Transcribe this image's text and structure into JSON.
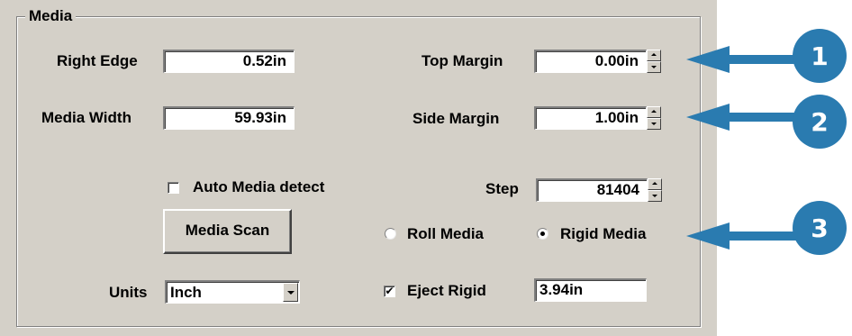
{
  "media_group": {
    "title": "Media",
    "right_edge": {
      "label": "Right Edge",
      "value": "0.52in"
    },
    "media_width": {
      "label": "Media Width",
      "value": "59.93in"
    },
    "top_margin": {
      "label": "Top Margin",
      "value": "0.00in"
    },
    "side_margin": {
      "label": "Side Margin",
      "value": "1.00in"
    },
    "auto_detect": {
      "label": "Auto Media detect",
      "checked": false
    },
    "step": {
      "label": "Step",
      "value": "81404"
    },
    "media_scan_button": "Media Scan",
    "roll_media": {
      "label": "Roll Media",
      "selected": false
    },
    "rigid_media": {
      "label": "Rigid Media",
      "selected": true
    },
    "units": {
      "label": "Units",
      "value": "Inch"
    },
    "eject_rigid": {
      "label": "Eject Rigid",
      "checked": true,
      "value": "3.94in"
    }
  },
  "callouts": [
    "1",
    "2",
    "3"
  ],
  "colors": {
    "panel": "#d4d0c8",
    "callout": "#2a7bb0"
  },
  "icons": {
    "check_mark": "✔"
  }
}
